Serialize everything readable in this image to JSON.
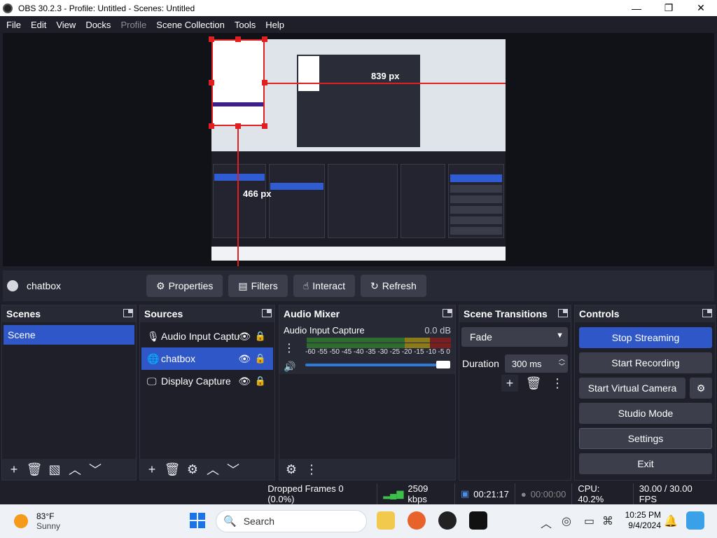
{
  "window": {
    "title": "OBS 30.2.3 - Profile: Untitled - Scenes: Untitled",
    "controls": [
      "—",
      "❐",
      "✕"
    ]
  },
  "menu": [
    "File",
    "Edit",
    "View",
    "Docks",
    "Profile",
    "Scene Collection",
    "Tools",
    "Help"
  ],
  "preview": {
    "label_width": "839 px",
    "label_height": "466 px"
  },
  "source_toolbar": {
    "source_name": "chatbox",
    "buttons": [
      "Properties",
      "Filters",
      "Interact",
      "Refresh"
    ]
  },
  "scenes": {
    "title": "Scenes",
    "items": [
      "Scene"
    ]
  },
  "sources": {
    "title": "Sources",
    "items": [
      {
        "label": "Audio Input Captu",
        "icon": "microphone-icon"
      },
      {
        "label": "chatbox",
        "icon": "browser-globe-icon"
      },
      {
        "label": "Display Capture",
        "icon": "monitor-icon"
      }
    ]
  },
  "mixer": {
    "title": "Audio Mixer",
    "channel": "Audio Input Capture",
    "level": "0.0 dB",
    "ticks": "-60 -55 -50 -45 -40 -35 -30 -25 -20 -15 -10 -5  0",
    "volume_fraction": 1.0
  },
  "transitions": {
    "title": "Scene Transitions",
    "selected": "Fade",
    "duration_label": "Duration",
    "duration_value": "300 ms"
  },
  "controls": {
    "title": "Controls",
    "buttons": [
      "Stop Streaming",
      "Start Recording",
      "Start Virtual Camera",
      "Studio Mode",
      "Settings",
      "Exit"
    ]
  },
  "status": {
    "dropped": "Dropped Frames 0 (0.0%)",
    "bitrate": "2509 kbps",
    "stream_time": "00:21:17",
    "rec_time": "00:00:00",
    "cpu": "CPU: 40.2%",
    "fps": "30.00 / 30.00 FPS"
  },
  "taskbar": {
    "weather_temp": "83°F",
    "weather_desc": "Sunny",
    "search_placeholder": "Search",
    "time": "10:25 PM",
    "date": "9/4/2024"
  },
  "colors": {
    "accent": "#2f57c8",
    "background": "#1e1f29",
    "panel": "#272935",
    "selection": "#e02020"
  }
}
